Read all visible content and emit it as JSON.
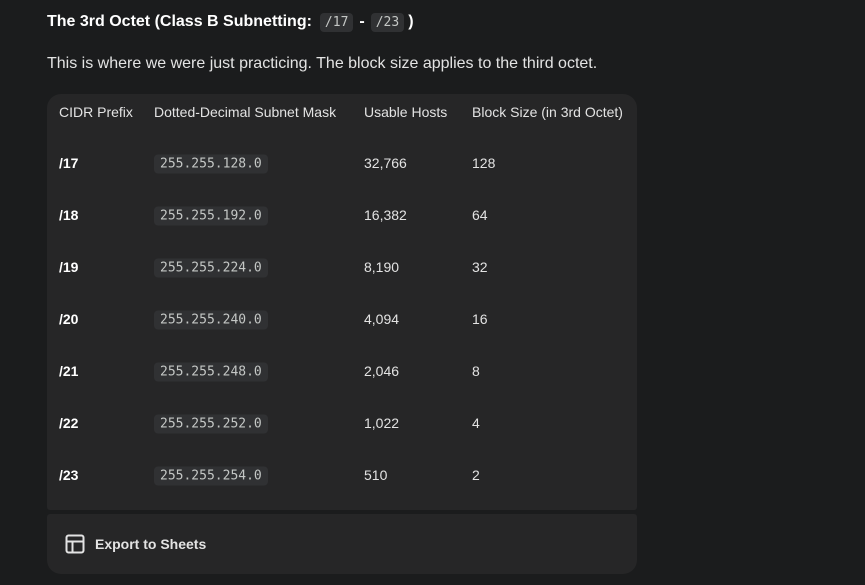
{
  "heading": {
    "text": "The 3rd Octet (Class B Subnetting:",
    "code_start": "/17",
    "separator": "-",
    "code_end": "/23",
    "close_paren": ")"
  },
  "intro": "This is where we were just practicing. The block size applies to the third octet.",
  "table": {
    "headers": [
      "CIDR Prefix",
      "Dotted-Decimal Subnet Mask",
      "Usable Hosts",
      "Block Size (in 3rd Octet)"
    ],
    "rows": [
      {
        "prefix": "/17",
        "mask": "255.255.128.0",
        "hosts": "32,766",
        "block": "128"
      },
      {
        "prefix": "/18",
        "mask": "255.255.192.0",
        "hosts": "16,382",
        "block": "64"
      },
      {
        "prefix": "/19",
        "mask": "255.255.224.0",
        "hosts": "8,190",
        "block": "32"
      },
      {
        "prefix": "/20",
        "mask": "255.255.240.0",
        "hosts": "4,094",
        "block": "16"
      },
      {
        "prefix": "/21",
        "mask": "255.255.248.0",
        "hosts": "2,046",
        "block": "8"
      },
      {
        "prefix": "/22",
        "mask": "255.255.252.0",
        "hosts": "1,022",
        "block": "4"
      },
      {
        "prefix": "/23",
        "mask": "255.255.254.0",
        "hosts": "510",
        "block": "2"
      }
    ]
  },
  "export": {
    "label": "Export to Sheets",
    "icon": "table-grid-icon"
  },
  "colors": {
    "background": "#1b1c1d",
    "card": "#262627",
    "code_bg": "#303133",
    "text": "#e3e3e3"
  }
}
